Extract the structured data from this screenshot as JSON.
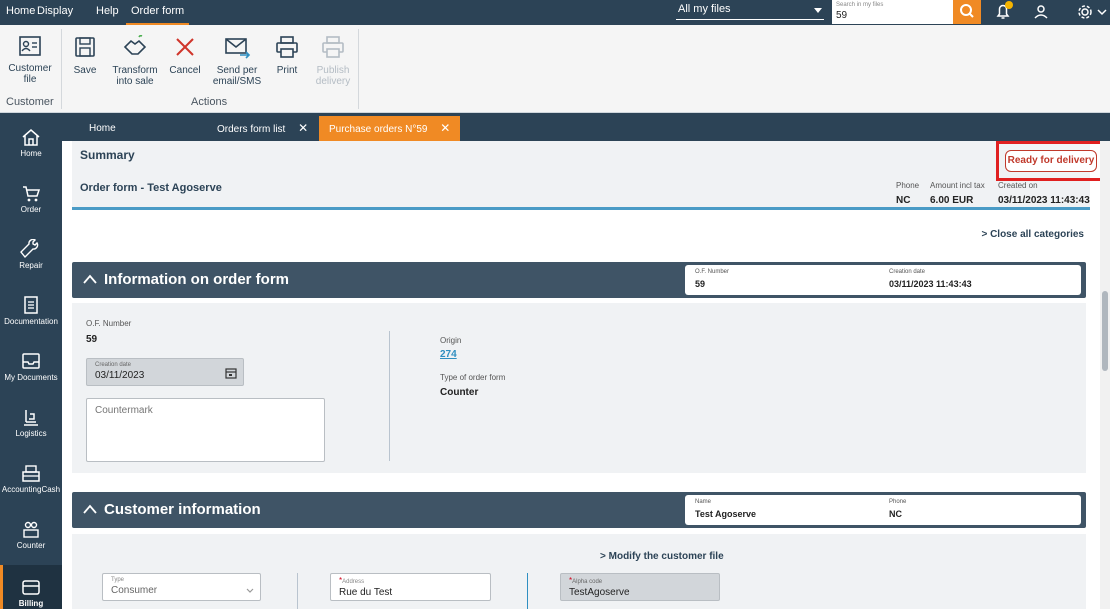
{
  "menu": {
    "items": [
      "Home",
      "Display",
      "Help",
      "Order form"
    ],
    "scope_selector": "All my files",
    "search": {
      "label": "Search in my files",
      "value": "59"
    }
  },
  "ribbon": {
    "customer_file_label": "Customer file",
    "customer_group_label": "Customer",
    "save_label": "Save",
    "transform_label": "Transform into sale",
    "cancel_label": "Cancel",
    "send_label": "Send per email/SMS",
    "print_label": "Print",
    "publish_label": "Publish delivery",
    "actions_group_label": "Actions"
  },
  "sidebar": {
    "items": [
      {
        "label": "Home",
        "icon": "home-icon"
      },
      {
        "label": "Order",
        "icon": "cart-icon"
      },
      {
        "label": "Repair",
        "icon": "wrench-icon"
      },
      {
        "label": "Documentation",
        "icon": "document-icon"
      },
      {
        "label": "My Documents",
        "icon": "inbox-icon"
      },
      {
        "label": "Logistics",
        "icon": "forklift-icon"
      },
      {
        "label": "AccountingCash",
        "icon": "cash-register-icon"
      },
      {
        "label": "Counter",
        "icon": "people-icon"
      },
      {
        "label": "Billing",
        "icon": "card-icon"
      }
    ]
  },
  "tabs": [
    {
      "label": "Home"
    },
    {
      "label": "Orders form list"
    },
    {
      "label": "Purchase orders N°59"
    }
  ],
  "summary": {
    "title": "Summary",
    "order_title": "Order form - Test Agoserve",
    "status": "Ready for delivery",
    "phone_label": "Phone",
    "phone_value": "NC",
    "amount_label": "Amount incl tax",
    "amount_value": "6.00 EUR",
    "created_label": "Created on",
    "created_value": "03/11/2023 11:43:43"
  },
  "close_all": "Close all categories",
  "info_section": {
    "title": "Information on order form",
    "of_number_label": "O.F. Number",
    "of_number_value": "59",
    "creation_label": "Creation date",
    "creation_value": "03/11/2023 11:43:43",
    "form": {
      "of_number_label": "O.F. Number",
      "of_number_value": "59",
      "creation_date_label": "Creation date",
      "creation_date_value": "03/11/2023",
      "countermark_placeholder": "Countermark",
      "origin_label": "Origin",
      "origin_value": "274",
      "type_label": "Type of order form",
      "type_value": "Counter"
    }
  },
  "customer_section": {
    "title": "Customer information",
    "name_label": "Name",
    "name_value": "Test Agoserve",
    "phone_label": "Phone",
    "phone_value": "NC",
    "modify_link": "Modify the customer file",
    "type_label": "Type",
    "type_value": "Consumer",
    "address_label": "Address",
    "address_value": "Rue du Test",
    "alpha_label": "Alpha code",
    "alpha_value": "TestAgoserve"
  }
}
